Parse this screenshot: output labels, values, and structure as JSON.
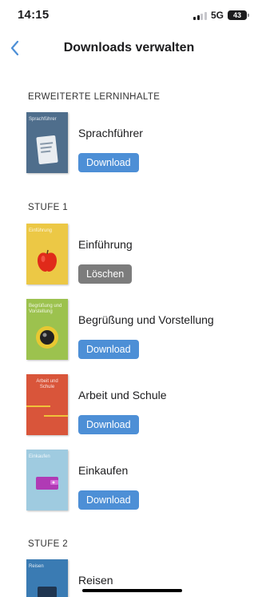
{
  "status_bar": {
    "time": "14:15",
    "network": "5G",
    "battery": "43"
  },
  "nav": {
    "title": "Downloads verwalten",
    "back_icon": "chevron-left-icon"
  },
  "colors": {
    "accent": "#4d8fd6",
    "delete": "#7c7c7c"
  },
  "sections": [
    {
      "header": "ERWEITERTE LERNINHALTE",
      "items": [
        {
          "title": "Sprachführer",
          "cover_label": "Sprachführer",
          "cover_color": "#4f6e8c",
          "button": "Download",
          "button_type": "download"
        }
      ]
    },
    {
      "header": "STUFE 1",
      "items": [
        {
          "title": "Einführung",
          "cover_label": "Einführung",
          "cover_color": "#ecc845",
          "button": "Löschen",
          "button_type": "delete"
        },
        {
          "title": "Begrüßung und Vorstellung",
          "cover_label": "Begrüßung und Vorstellung",
          "cover_color": "#9cc24e",
          "button": "Download",
          "button_type": "download"
        },
        {
          "title": "Arbeit und Schule",
          "cover_label": "Arbeit und Schule",
          "cover_color": "#d9553a",
          "button": "Download",
          "button_type": "download"
        },
        {
          "title": "Einkaufen",
          "cover_label": "Einkaufen",
          "cover_color": "#9fcbe0",
          "button": "Download",
          "button_type": "download"
        }
      ]
    },
    {
      "header": "STUFE 2",
      "items": [
        {
          "title": "Reisen",
          "cover_label": "Reisen",
          "cover_color": "#3a7bb3",
          "button": "",
          "button_type": "download"
        }
      ]
    }
  ]
}
